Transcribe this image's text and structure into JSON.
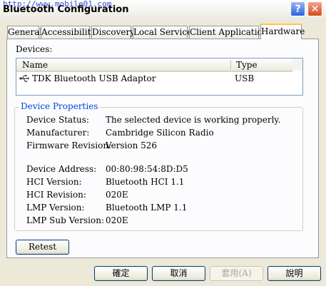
{
  "window": {
    "watermark": "http://www.mobile01.com",
    "title": "Bluetooth Configuration",
    "help_label": "?",
    "close_label": "✕"
  },
  "tabs": [
    {
      "label": "General"
    },
    {
      "label": "Accessibility"
    },
    {
      "label": "Discovery"
    },
    {
      "label": "Local Services"
    },
    {
      "label": "Client Applications"
    },
    {
      "label": "Hardware",
      "active": true
    }
  ],
  "devices": {
    "label": "Devices:",
    "columns": [
      "Name",
      "Type"
    ],
    "rows": [
      {
        "icon": "usb-icon",
        "name": "TDK Bluetooth USB Adaptor",
        "type": "USB"
      }
    ]
  },
  "properties": {
    "title": "Device Properties",
    "items": [
      {
        "label": "Device Status:",
        "value": "The selected device is working properly."
      },
      {
        "label": "Manufacturer:",
        "value": "Cambridge Silicon Radio"
      },
      {
        "label": "Firmware Revision:",
        "value": "Version 526"
      },
      {
        "label": "Device Address:",
        "value": "00:80:98:54:8D:D5"
      },
      {
        "label": "HCI Version:",
        "value": "Bluetooth HCI 1.1"
      },
      {
        "label": "HCI Revision:",
        "value": "020E"
      },
      {
        "label": "LMP Version:",
        "value": "Bluetooth LMP 1.1"
      },
      {
        "label": "LMP Sub Version:",
        "value": "020E"
      }
    ]
  },
  "buttons": {
    "reset": "Retest",
    "ok": "確定",
    "cancel": "取消",
    "apply": "套用(A)",
    "help": "說明"
  }
}
